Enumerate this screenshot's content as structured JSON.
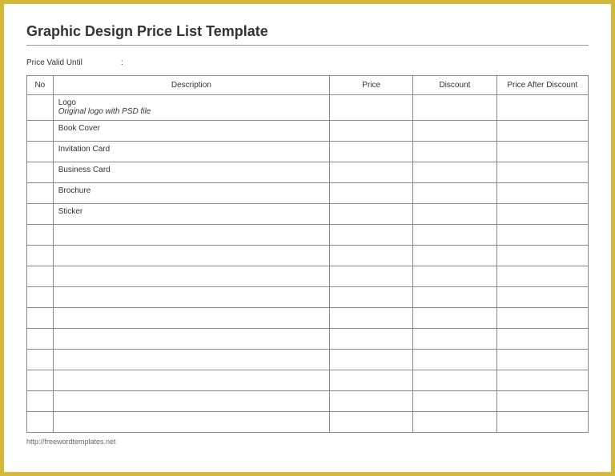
{
  "title": "Graphic Design Price List Template",
  "valid_label": "Price Valid Until",
  "headers": {
    "no": "No",
    "description": "Description",
    "price": "Price",
    "discount": "Discount",
    "after": "Price After Discount"
  },
  "rows": [
    {
      "no": "",
      "description": "Logo",
      "sub": "Original logo with PSD file",
      "price": "",
      "discount": "",
      "after": ""
    },
    {
      "no": "",
      "description": "Book Cover",
      "sub": "",
      "price": "",
      "discount": "",
      "after": ""
    },
    {
      "no": "",
      "description": "Invitation Card",
      "sub": "",
      "price": "",
      "discount": "",
      "after": ""
    },
    {
      "no": "",
      "description": "Business Card",
      "sub": "",
      "price": "",
      "discount": "",
      "after": ""
    },
    {
      "no": "",
      "description": "Brochure",
      "sub": "",
      "price": "",
      "discount": "",
      "after": ""
    },
    {
      "no": "",
      "description": "Sticker",
      "sub": "",
      "price": "",
      "discount": "",
      "after": ""
    },
    {
      "no": "",
      "description": "",
      "sub": "",
      "price": "",
      "discount": "",
      "after": ""
    },
    {
      "no": "",
      "description": "",
      "sub": "",
      "price": "",
      "discount": "",
      "after": ""
    },
    {
      "no": "",
      "description": "",
      "sub": "",
      "price": "",
      "discount": "",
      "after": ""
    },
    {
      "no": "",
      "description": "",
      "sub": "",
      "price": "",
      "discount": "",
      "after": ""
    },
    {
      "no": "",
      "description": "",
      "sub": "",
      "price": "",
      "discount": "",
      "after": ""
    },
    {
      "no": "",
      "description": "",
      "sub": "",
      "price": "",
      "discount": "",
      "after": ""
    },
    {
      "no": "",
      "description": "",
      "sub": "",
      "price": "",
      "discount": "",
      "after": ""
    },
    {
      "no": "",
      "description": "",
      "sub": "",
      "price": "",
      "discount": "",
      "after": ""
    },
    {
      "no": "",
      "description": "",
      "sub": "",
      "price": "",
      "discount": "",
      "after": ""
    },
    {
      "no": "",
      "description": "",
      "sub": "",
      "price": "",
      "discount": "",
      "after": ""
    }
  ],
  "footer": "http://freewordtemplates.net"
}
